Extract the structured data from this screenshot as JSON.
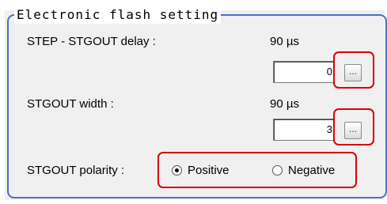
{
  "group": {
    "title": "Electronic flash setting"
  },
  "step_delay": {
    "label": "STEP - STGOUT delay :",
    "value": "90",
    "unit": "µs",
    "input_value": "0",
    "button_label": "..."
  },
  "stgout_width": {
    "label": "STGOUT width :",
    "value": "90",
    "unit": "µs",
    "input_value": "3",
    "button_label": "..."
  },
  "polarity": {
    "label": "STGOUT polarity :",
    "options": [
      {
        "label": "Positive",
        "selected": true
      },
      {
        "label": "Negative",
        "selected": false
      }
    ]
  },
  "colors": {
    "frame": "#4472c4",
    "highlight": "#d9000d",
    "panel": "#f0f0f0"
  }
}
